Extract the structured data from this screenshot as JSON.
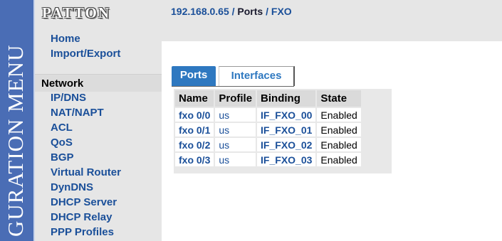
{
  "side_banner": {
    "text": "GURATION MENU"
  },
  "logo": {
    "text": "PATTON"
  },
  "nav": {
    "top_items": [
      {
        "label": "Home"
      },
      {
        "label": "Import/Export"
      }
    ],
    "section": {
      "label": "Network"
    },
    "sub_items": [
      {
        "label": "IP/DNS"
      },
      {
        "label": "NAT/NAPT"
      },
      {
        "label": "ACL"
      },
      {
        "label": "QoS"
      },
      {
        "label": "BGP"
      },
      {
        "label": "Virtual Router"
      },
      {
        "label": "DynDNS"
      },
      {
        "label": "DHCP Server"
      },
      {
        "label": "DHCP Relay"
      },
      {
        "label": "PPP Profiles"
      }
    ]
  },
  "breadcrumb": {
    "host": "192.168.0.65",
    "sep1": " / ",
    "section": "Ports",
    "sep2": " / ",
    "page": "FXO"
  },
  "tabs": [
    {
      "label": "Ports",
      "active": true
    },
    {
      "label": "Interfaces",
      "active": false
    }
  ],
  "table": {
    "headers": [
      "Name",
      "Profile",
      "Binding",
      "State"
    ],
    "rows": [
      {
        "name": "fxo 0/0",
        "profile": "us",
        "binding": "IF_FXO_00",
        "state": "Enabled"
      },
      {
        "name": "fxo 0/1",
        "profile": "us",
        "binding": "IF_FXO_01",
        "state": "Enabled"
      },
      {
        "name": "fxo 0/2",
        "profile": "us",
        "binding": "IF_FXO_02",
        "state": "Enabled"
      },
      {
        "name": "fxo 0/3",
        "profile": "us",
        "binding": "IF_FXO_03",
        "state": "Enabled"
      }
    ]
  },
  "colors": {
    "side_band": "#4a6db5",
    "link": "#1a4f99",
    "active_tab": "#2e78c0",
    "panel_bg": "#e6e6e6"
  }
}
